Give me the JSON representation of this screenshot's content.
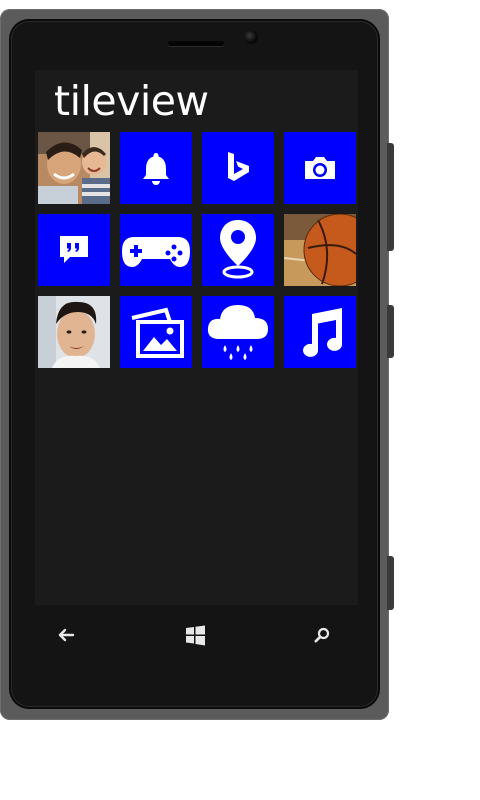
{
  "app": {
    "title": "tileview"
  },
  "tiles": [
    {
      "kind": "photo",
      "icon": "family-photo"
    },
    {
      "kind": "icon",
      "icon": "bell-icon"
    },
    {
      "kind": "icon",
      "icon": "bing-icon"
    },
    {
      "kind": "icon",
      "icon": "camera-icon"
    },
    {
      "kind": "icon",
      "icon": "quote-bubble-icon"
    },
    {
      "kind": "icon",
      "icon": "gamepad-icon"
    },
    {
      "kind": "icon",
      "icon": "map-pin-icon"
    },
    {
      "kind": "photo",
      "icon": "basketball-photo"
    },
    {
      "kind": "photo",
      "icon": "man-portrait-photo"
    },
    {
      "kind": "icon",
      "icon": "pictures-icon"
    },
    {
      "kind": "icon",
      "icon": "rain-cloud-icon"
    },
    {
      "kind": "icon",
      "icon": "music-note-icon"
    }
  ],
  "nav": {
    "back": "back-arrow-icon",
    "start": "windows-logo-icon",
    "search": "search-icon"
  },
  "colors": {
    "tile_accent": "#0000ff",
    "screen_background": "#1b1b1b",
    "phone_frame": "#5b5b5b"
  }
}
